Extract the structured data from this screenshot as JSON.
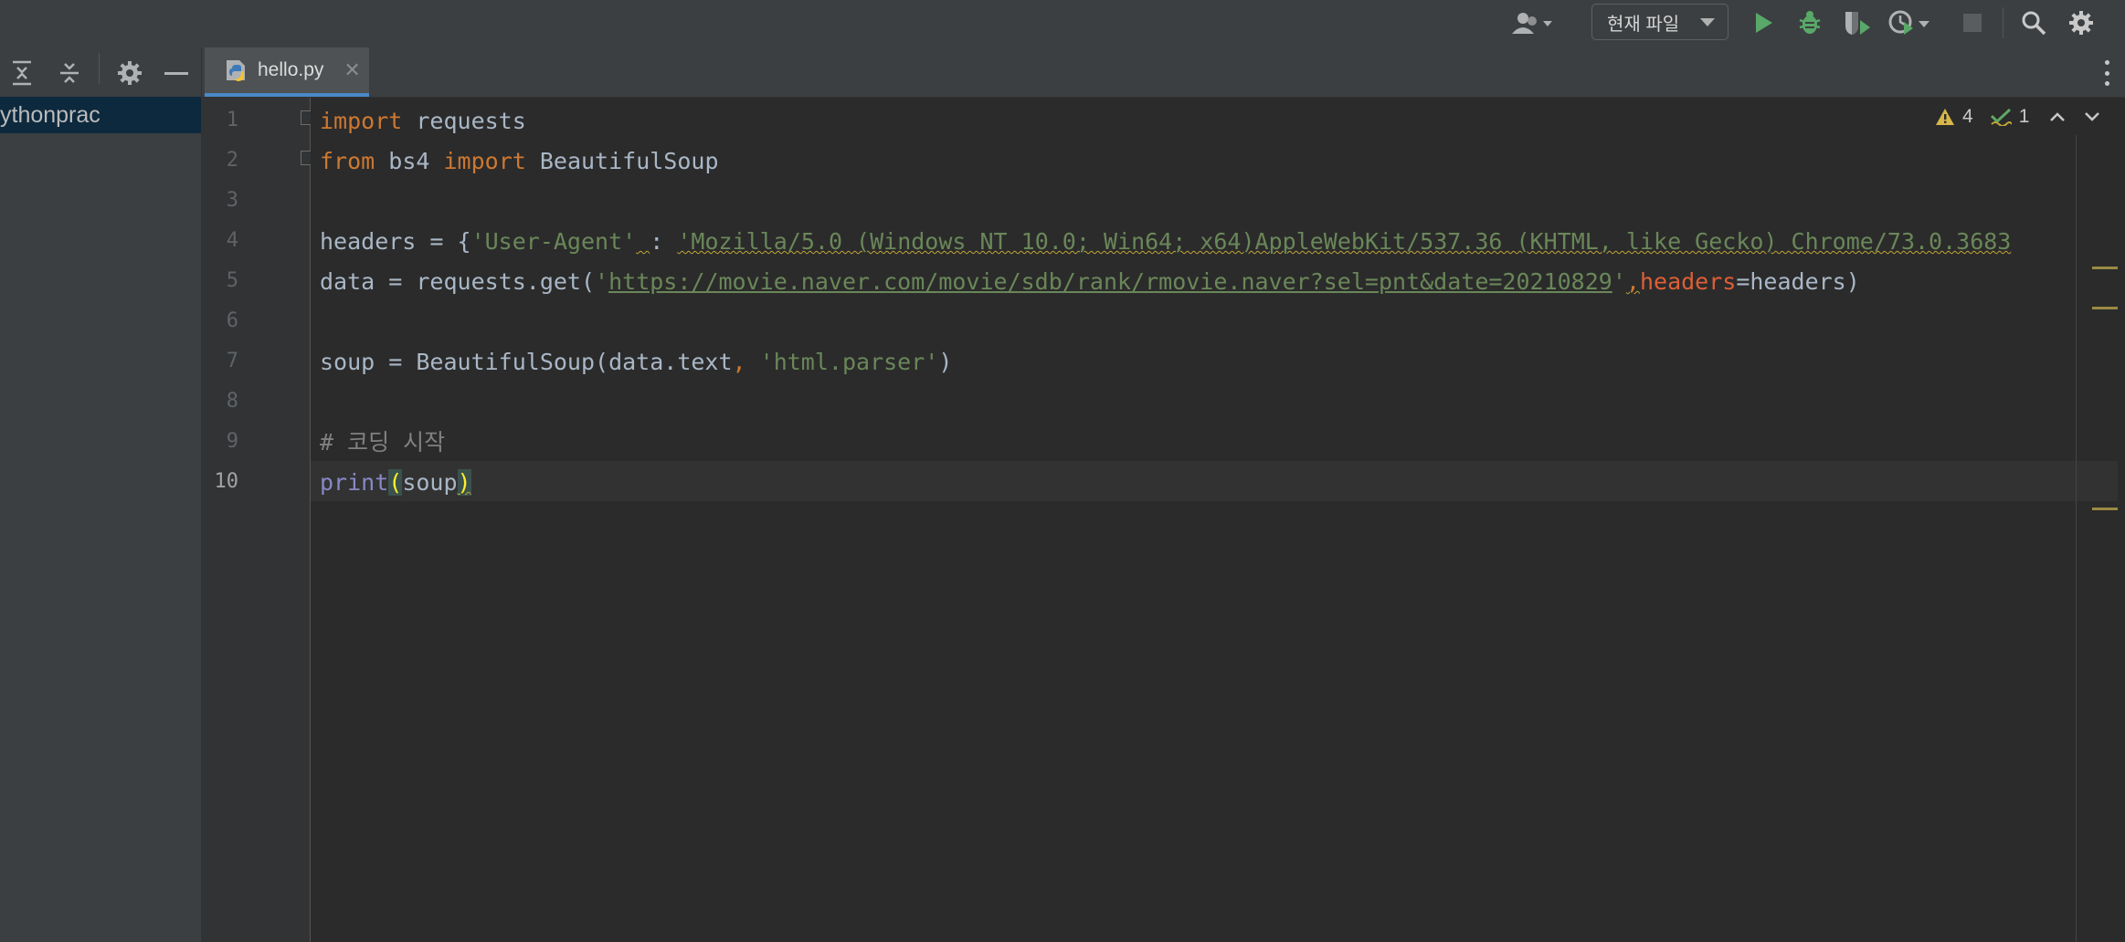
{
  "toolbar": {
    "run_config_label": "현재 파일",
    "icons": [
      "user-icon",
      "run-icon",
      "debug-icon",
      "coverage-icon",
      "profile-icon",
      "stop-icon",
      "search-icon",
      "settings-icon"
    ]
  },
  "project_panel": {
    "root_label": "ythonprac"
  },
  "tabs": [
    {
      "label": "hello.py",
      "active": true
    }
  ],
  "inspections": {
    "warnings": "4",
    "weak_warnings": "1"
  },
  "editor": {
    "current_line": 10,
    "lines": [
      {
        "num": "1",
        "tokens": [
          {
            "t": "import",
            "c": "kw"
          },
          {
            "t": " requests",
            "c": "plain"
          }
        ]
      },
      {
        "num": "2",
        "tokens": [
          {
            "t": "from",
            "c": "kw"
          },
          {
            "t": " bs4 ",
            "c": "plain"
          },
          {
            "t": "import",
            "c": "kw"
          },
          {
            "t": " BeautifulSoup",
            "c": "plain"
          }
        ]
      },
      {
        "num": "3",
        "tokens": []
      },
      {
        "num": "4",
        "tokens": [
          {
            "t": "headers = {",
            "c": "plain"
          },
          {
            "t": "'User-Agent'",
            "c": "str"
          },
          {
            "t": " ",
            "c": "plain warn"
          },
          {
            "t": ": ",
            "c": "plain"
          },
          {
            "t": "'Mozilla/5.0 (Windows NT 10.0; Win64; x64)AppleWebKit/537.36 (KHTML, like Gecko) Chrome/73.0.3683",
            "c": "str warn"
          }
        ]
      },
      {
        "num": "5",
        "tokens": [
          {
            "t": "data = requests.get(",
            "c": "plain"
          },
          {
            "t": "'",
            "c": "str"
          },
          {
            "t": "https://movie.naver.com/movie/sdb/rank/rmovie.naver?sel=pnt&date=20210829",
            "c": "link"
          },
          {
            "t": "'",
            "c": "str"
          },
          {
            "t": ",",
            "c": "kw warn"
          },
          {
            "t": "headers",
            "c": "param"
          },
          {
            "t": "=headers)",
            "c": "plain"
          }
        ]
      },
      {
        "num": "6",
        "tokens": []
      },
      {
        "num": "7",
        "tokens": [
          {
            "t": "soup = BeautifulSoup(data.text",
            "c": "plain"
          },
          {
            "t": ", ",
            "c": "kw"
          },
          {
            "t": "'html.parser'",
            "c": "str"
          },
          {
            "t": ")",
            "c": "plain"
          }
        ]
      },
      {
        "num": "8",
        "tokens": []
      },
      {
        "num": "9",
        "tokens": [
          {
            "t": "# 코딩 시작",
            "c": "cm"
          }
        ]
      },
      {
        "num": "10",
        "tokens": [
          {
            "t": "print",
            "c": "fn"
          },
          {
            "t": "(",
            "c": "brace-hl"
          },
          {
            "t": "soup",
            "c": "plain"
          },
          {
            "t": ")",
            "c": "brace-hl warn"
          }
        ]
      }
    ]
  }
}
